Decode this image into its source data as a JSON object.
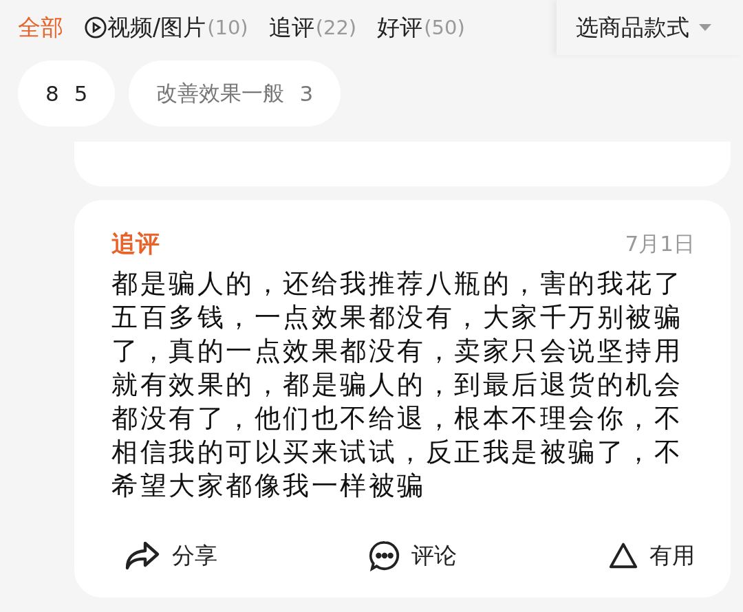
{
  "tabs": [
    {
      "label": "全部",
      "selected": true,
      "kind": "plain"
    },
    {
      "label": "视频/图片",
      "count": "(10)",
      "selected": false,
      "kind": "video"
    },
    {
      "label": "追评",
      "count": "(22)",
      "selected": false,
      "kind": "plain"
    },
    {
      "label": "好评",
      "count": "(50)",
      "selected": false,
      "kind": "plain"
    }
  ],
  "style_filter": {
    "label": "选商品款式"
  },
  "tags": [
    {
      "label": "8",
      "count": "5"
    },
    {
      "label": "改善效果一般",
      "count": "3"
    }
  ],
  "review": {
    "title": "追评",
    "date": "7月1日",
    "text": "都是骗人的，还给我推荐八瓶的，害的我花了五百多钱，一点效果都没有，大家千万别被骗了，真的一点效果都没有，卖家只会说坚持用就有效果的，都是骗人的，到最后退货的机会都没有了，他们也不给退，根本不理会你，不相信我的可以买来试试，反正我是被骗了，不希望大家都像我一样被骗",
    "actions": [
      {
        "label": "分享",
        "kind": "share"
      },
      {
        "label": "评论",
        "kind": "comment"
      },
      {
        "label": "有用",
        "kind": "useful"
      }
    ]
  }
}
